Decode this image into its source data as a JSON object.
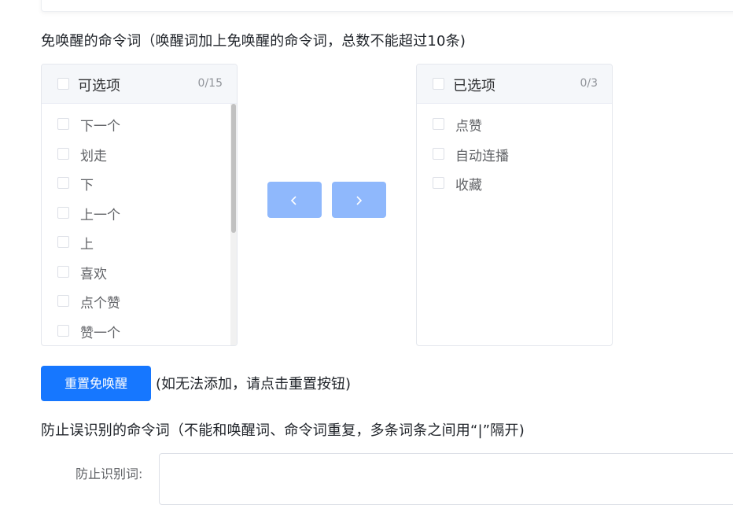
{
  "section1": {
    "title": "免唤醒的命令词（唤醒词加上免唤醒的命令词，总数不能超过10条)"
  },
  "left_panel": {
    "title": "可选项",
    "count": "0/15",
    "items": [
      "下一个",
      "划走",
      "下",
      "上一个",
      "上",
      "喜欢",
      "点个赞",
      "赞一个"
    ]
  },
  "right_panel": {
    "title": "已选项",
    "count": "0/3",
    "items": [
      "点赞",
      "自动连播",
      "收藏"
    ]
  },
  "transfer": {
    "left_icon": "chevron-left-icon",
    "right_icon": "chevron-right-icon"
  },
  "reset": {
    "button_label": "重置免唤醒",
    "hint": "(如无法添加，请点击重置按钮)"
  },
  "section2": {
    "title": "防止误识别的命令词（不能和唤醒词、命令词重复，多条词条之间用“|”隔开)"
  },
  "form": {
    "label": "防止识别词:",
    "value": ""
  },
  "colors": {
    "primary": "#1677ff",
    "disabled_primary": "#8fb8fc"
  }
}
